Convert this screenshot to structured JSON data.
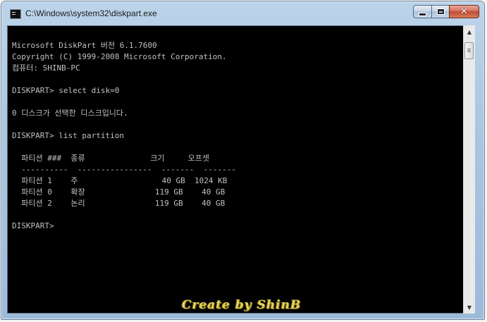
{
  "window": {
    "title": "C:\\Windows\\system32\\diskpart.exe",
    "minimize_label": "minimize",
    "maximize_label": "maximize",
    "close_label": "✕"
  },
  "console": {
    "lines": [
      "Microsoft DiskPart 버전 6.1.7600",
      "Copyright (C) 1999-2008 Microsoft Corporation.",
      "컴퓨터: SHINB-PC",
      "",
      "DISKPART> select disk=0",
      "",
      "0 디스크가 선택한 디스크입니다.",
      "",
      "DISKPART> list partition",
      "",
      "  파티션 ###  종류              크기     오프셋",
      "  ----------  ----------------  -------  -------",
      "  파티션 1    주                  40 GB  1024 KB",
      "  파티션 0    확장               119 GB    40 GB",
      "  파티션 2    논리               119 GB    40 GB",
      "",
      "DISKPART> "
    ]
  },
  "watermark": "Create by ShinB",
  "colors": {
    "console_bg": "#000000",
    "console_fg": "#c0c0c0",
    "watermark": "#e3d15a"
  }
}
